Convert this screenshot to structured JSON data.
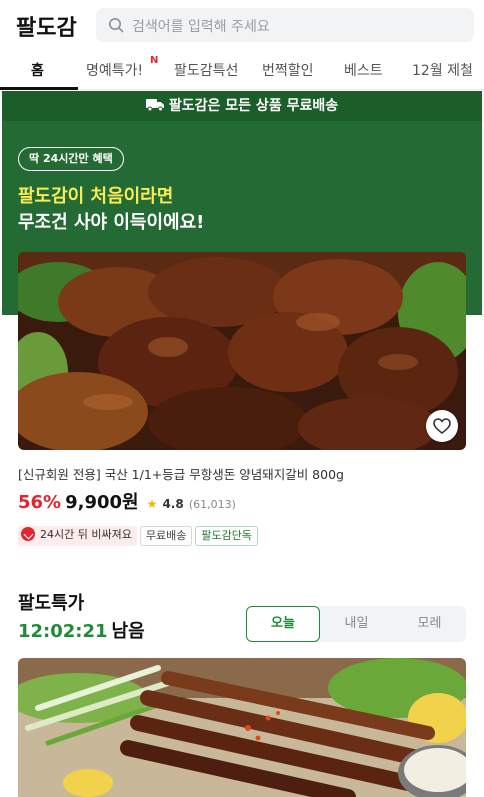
{
  "header": {
    "logo": "팔도감",
    "search_placeholder": "검색어를 입력해 주세요",
    "search_icon": "search-icon"
  },
  "tabs": [
    {
      "label": "홈",
      "active": true
    },
    {
      "label": "명예특가!",
      "new_badge": "N"
    },
    {
      "label": "팔도감특선"
    },
    {
      "label": "번쩍할인"
    },
    {
      "label": "베스트"
    },
    {
      "label": "12월 제철"
    }
  ],
  "banner": {
    "shipping_text": "팔도감은 모든 상품 무료배송",
    "shipping_icon": "truck-icon",
    "badge": "딱 24시간만 혜택",
    "headline_line1": "팔도감이 처음이라면",
    "headline_line2": "무조건 사야 이득이에요!",
    "colors": {
      "bar": "#1c5e2a",
      "bg": "#246a34",
      "highlight": "#f7ec57"
    }
  },
  "product": {
    "title": "[신규회원 전용] 국산 1/1+등급 무항생돈 양념돼지갈비 800g",
    "discount": "56%",
    "price": "9,900원",
    "rating": "4.8",
    "review_count": "(61,013)",
    "tags": [
      "24시간 뒤 비싸져요",
      "무료배송",
      "팔도감단독"
    ],
    "heart_icon": "heart-icon"
  },
  "deal": {
    "title": "팔도특가",
    "timer": "12:02:21",
    "timer_suffix": "남음",
    "segments": [
      {
        "label": "오늘",
        "active": true
      },
      {
        "label": "내일"
      },
      {
        "label": "모레"
      }
    ],
    "accent": "#1e8b36"
  }
}
